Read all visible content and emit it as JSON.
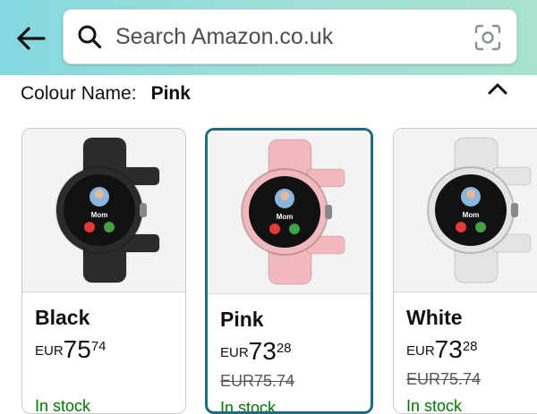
{
  "header": {
    "back_icon": "arrow-left-icon",
    "search": {
      "placeholder": "Search Amazon.co.uk",
      "search_icon": "search-icon",
      "camera_icon": "camera-scan-icon"
    }
  },
  "variation": {
    "label": "Colour Name:",
    "selected_value": "Pink",
    "collapse_icon": "chevron-up-icon"
  },
  "swatches": [
    {
      "name": "Black",
      "currency": "EUR",
      "whole": "75",
      "fraction": "74",
      "was_price": "",
      "stock": "In stock",
      "selected": false,
      "band_color": "#2b2b2b"
    },
    {
      "name": "Pink",
      "currency": "EUR",
      "whole": "73",
      "fraction": "28",
      "was_price": "EUR75.74",
      "stock": "In stock",
      "selected": true,
      "band_color": "#f1b8bd"
    },
    {
      "name": "White",
      "currency": "EUR",
      "whole": "73",
      "fraction": "28",
      "was_price": "EUR75.74",
      "stock": "In stock",
      "selected": false,
      "band_color": "#e4e4e4"
    }
  ],
  "watch_screen": {
    "caller": "Mom"
  },
  "colors": {
    "accent_border": "#1f6e80",
    "stock_green": "#007600",
    "header_gradient_start": "#84d8e0"
  }
}
